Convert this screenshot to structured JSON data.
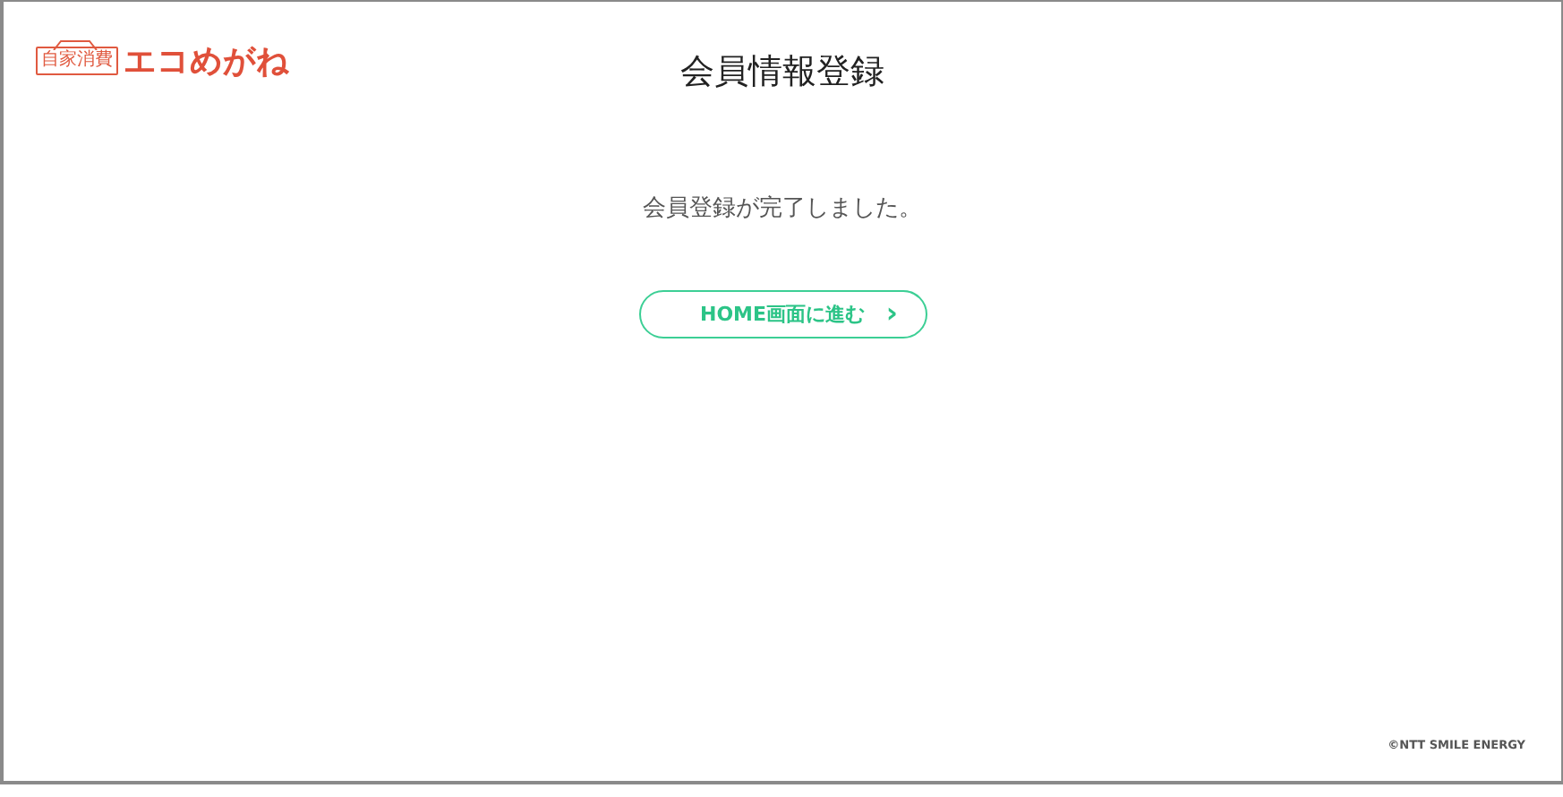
{
  "logo": {
    "badge": "自家消費",
    "name": "エコめがね"
  },
  "page_title": "会員情報登録",
  "message": "会員登録が完了しました。",
  "home_button": {
    "label": "HOME画面に進む",
    "arrow": "›"
  },
  "footer": {
    "copyright": "©NTT SMILE ENERGY"
  }
}
